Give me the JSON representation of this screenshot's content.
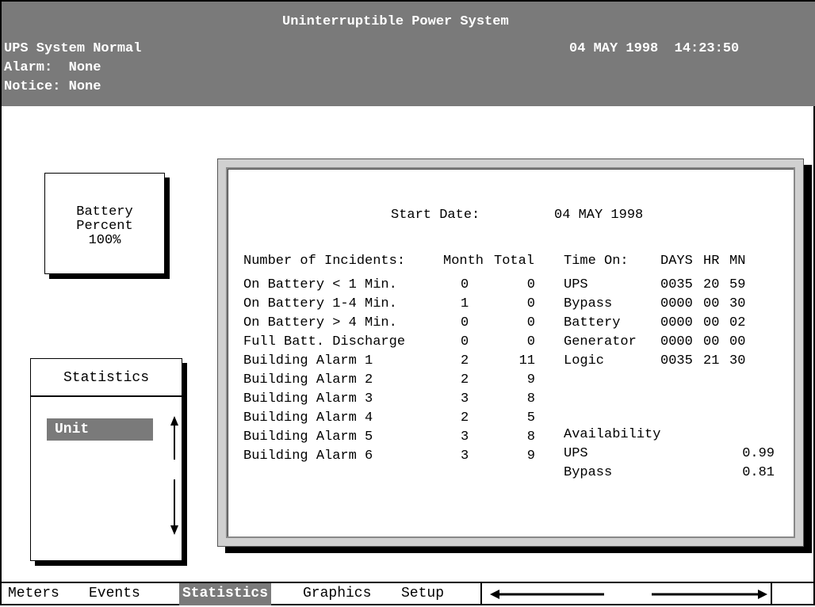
{
  "header": {
    "title": "Uninterruptible Power System",
    "status": "UPS System Normal",
    "datetime": "04 MAY 1998  14:23:50",
    "alarm": "Alarm:  None",
    "notice": "Notice: None"
  },
  "battery": {
    "line1": "Battery",
    "line2": "Percent",
    "line3": "100%"
  },
  "stats_menu": {
    "title": "Statistics",
    "item": "Unit"
  },
  "panel": {
    "start_label": "Start Date:",
    "start_value": "04 MAY 1998",
    "incidents_header": {
      "label": "Number of Incidents:",
      "month": "Month",
      "total": "Total"
    },
    "time_header": {
      "label": "Time On:",
      "days": "DAYS",
      "hr": "HR",
      "mn": "MN"
    },
    "incidents": [
      {
        "name": "On Battery < 1 Min.",
        "month": "0",
        "total": "0"
      },
      {
        "name": "On Battery 1-4 Min.",
        "month": "1",
        "total": "0"
      },
      {
        "name": "On Battery > 4 Min.",
        "month": "0",
        "total": "0"
      },
      {
        "name": "Full Batt. Discharge",
        "month": "0",
        "total": "0"
      },
      {
        "name": "Building Alarm 1",
        "month": "2",
        "total": "11"
      },
      {
        "name": "Building Alarm 2",
        "month": "2",
        "total": "9"
      },
      {
        "name": "Building Alarm 3",
        "month": "3",
        "total": "8"
      },
      {
        "name": "Building Alarm 4",
        "month": "2",
        "total": "5"
      },
      {
        "name": "Building Alarm 5",
        "month": "3",
        "total": "8"
      },
      {
        "name": "Building Alarm 6",
        "month": "3",
        "total": "9"
      }
    ],
    "time_on": [
      {
        "name": "UPS",
        "days": "0035",
        "hr": "20",
        "mn": "59"
      },
      {
        "name": "Bypass",
        "days": "0000",
        "hr": "00",
        "mn": "30"
      },
      {
        "name": "Battery",
        "days": "0000",
        "hr": "00",
        "mn": "02"
      },
      {
        "name": "Generator",
        "days": "0000",
        "hr": "00",
        "mn": "00"
      },
      {
        "name": "Logic",
        "days": "0035",
        "hr": "21",
        "mn": "30"
      }
    ],
    "availability": {
      "label": "Availability",
      "rows": [
        {
          "name": "UPS",
          "value": "0.99"
        },
        {
          "name": "Bypass",
          "value": "0.81"
        }
      ]
    }
  },
  "bottom_tabs": [
    {
      "label": "Meters"
    },
    {
      "label": "Events"
    },
    {
      "label": "Statistics"
    },
    {
      "label": "Graphics"
    },
    {
      "label": "Setup"
    }
  ]
}
